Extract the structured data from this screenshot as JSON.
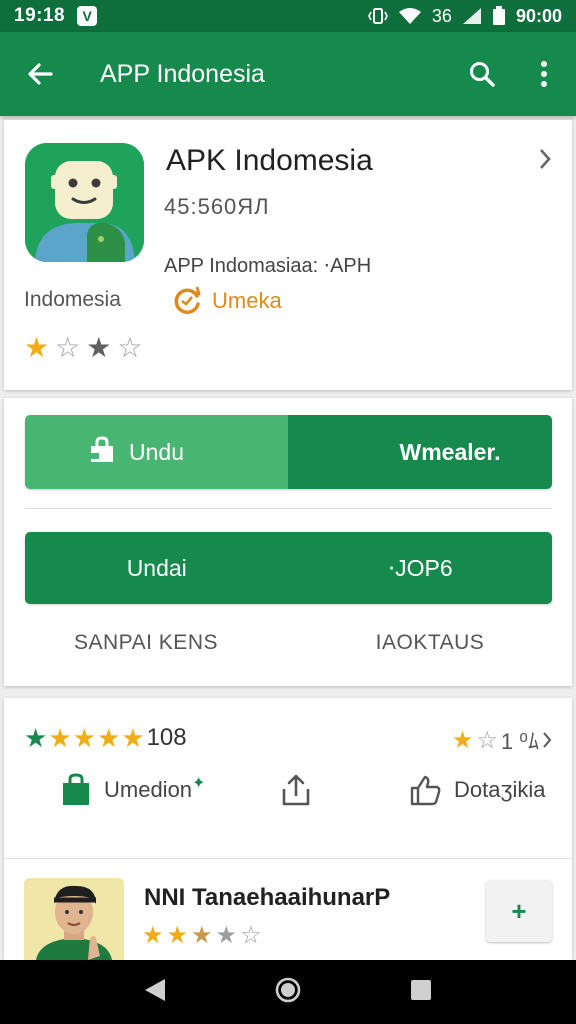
{
  "status_bar": {
    "time": "19:18",
    "notification_glyph": "V",
    "network_label": "36",
    "clock_right": "90:00"
  },
  "app_bar": {
    "title": "APP Indonesia"
  },
  "app_info": {
    "name": "APK Indomesia",
    "code": "45:560ЯЛ",
    "subtitle": "APP Indomasiaa: ⋅APH",
    "category": "Indomesia",
    "developer": "Umeka",
    "rating_stars": [
      "filled",
      "empty",
      "dark",
      "empty"
    ]
  },
  "actions": {
    "primary_left": "Undu",
    "primary_right": "Wmealer.",
    "secondary_left": "Undai",
    "secondary_right": "⋅JOP6",
    "tab_left": "SANPAI KENS",
    "tab_right": "IAOKTAUS"
  },
  "ratings": {
    "count": "108",
    "right_label": "1 ⁰ﾑ",
    "action_1": "Umedion",
    "action_3": "Dotaʒikia"
  },
  "review": {
    "name": "NNI TanaehaaihunarP",
    "stars": [
      "gold",
      "gold",
      "tan",
      "dark",
      "empty"
    ],
    "add_symbol": "+"
  },
  "colors": {
    "status_bar": "#0e6e3c",
    "app_bar": "#168a4d",
    "button_light": "#48b672",
    "accent_star": "#f0ad17",
    "developer": "#e08a1a"
  }
}
